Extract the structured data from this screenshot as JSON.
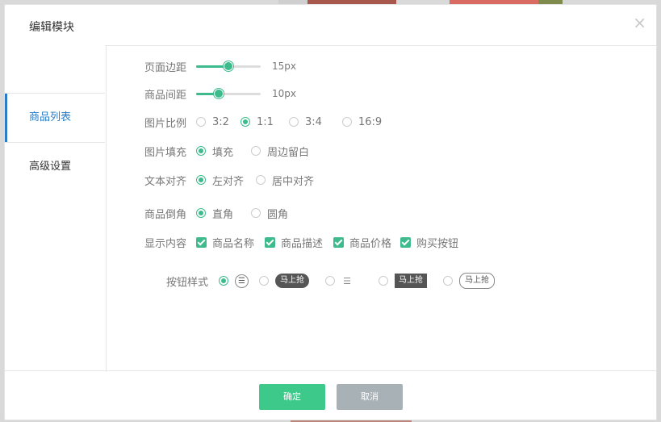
{
  "modal": {
    "title": "编辑模块",
    "close_glyph": "×"
  },
  "sidebar": {
    "items": [
      {
        "label": "商品列表",
        "active": true
      },
      {
        "label": "高级设置",
        "active": false
      }
    ]
  },
  "settings": {
    "page_margin": {
      "label": "页面边距",
      "value_text": "15px",
      "level": 0.5
    },
    "item_spacing": {
      "label": "商品间距",
      "value_text": "10px",
      "level": 0.35
    },
    "image_ratio": {
      "label": "图片比例",
      "options": [
        "3:2",
        "1:1",
        "3:4",
        "16:9"
      ],
      "selected": "1:1"
    },
    "image_fill": {
      "label": "图片填充",
      "options": [
        "填充",
        "周边留白"
      ],
      "selected": "填充"
    },
    "text_align": {
      "label": "文本对齐",
      "options": [
        "左对齐",
        "居中对齐"
      ],
      "selected": "左对齐"
    },
    "corner": {
      "label": "商品倒角",
      "options": [
        "直角",
        "圆角"
      ],
      "selected": "直角"
    },
    "display": {
      "label": "显示内容",
      "options": [
        "商品名称",
        "商品描述",
        "商品价格",
        "购买按钮"
      ],
      "checked": [
        "商品名称",
        "商品描述",
        "商品价格",
        "购买按钮"
      ]
    },
    "button_style": {
      "label": "按钮样式",
      "options": [
        {
          "kind": "icon-circle",
          "icon": "cart-icon",
          "glyph": "☰"
        },
        {
          "kind": "pill-dark",
          "text": "马上抢"
        },
        {
          "kind": "icon-plain",
          "icon": "cart-icon",
          "glyph": "☰"
        },
        {
          "kind": "rect-dark",
          "text": "马上抢"
        },
        {
          "kind": "pill-outline",
          "text": "马上抢"
        }
      ],
      "selected_index": 0
    }
  },
  "footer": {
    "ok_label": "确定",
    "cancel_label": "取消"
  },
  "colors": {
    "accent": "#3dbb8c",
    "active_tab": "#2b7cc7",
    "ok_button": "#3dc98a",
    "cancel_button": "#a8b1b6"
  }
}
